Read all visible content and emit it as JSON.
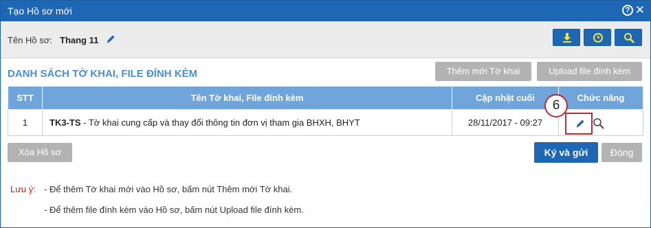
{
  "dialog": {
    "title": "Tạo Hồ sơ mới",
    "help_icon": "question-circle-icon",
    "close_icon": "close-icon"
  },
  "profile": {
    "label": "Tên Hồ sơ:",
    "name": "Thang 11",
    "edit_icon": "pencil-icon"
  },
  "toolbar": {
    "download_icon": "download-icon",
    "history_icon": "clock-icon",
    "search_icon": "search-icon",
    "accent": "#1d67b5"
  },
  "section": {
    "title": "DANH SÁCH TỜ KHAI, FILE ĐÍNH KÈM",
    "add_form_label": "Thêm mới Tờ khai",
    "upload_label": "Upload file đính kèm"
  },
  "table": {
    "headers": {
      "stt": "STT",
      "name": "Tên Tờ khai, File đính kèm",
      "updated": "Cập nhật cuối",
      "actions": "Chức năng"
    },
    "rows": [
      {
        "stt": "1",
        "code": "TK3-TS",
        "description": " - Tờ khai cung cấp và thay đổi thông tin đơn vị tham gia BHXH, BHYT",
        "updated": "28/11/2017 - 09:27",
        "actions": [
          "pencil-icon",
          "search-icon"
        ]
      }
    ]
  },
  "callout": {
    "step": "6",
    "color": "#c1272d"
  },
  "footer": {
    "delete_label": "Xóa Hồ sơ",
    "sign_send_label": "Ký và gửi",
    "close_label": "Đóng"
  },
  "notes": {
    "label": "Lưu ý:",
    "lines": [
      "- Để thêm Tờ khai mới vào Hồ sơ, bấm nút Thêm mới Tờ khai.",
      "- Để thêm file đính kèm vào Hồ sơ, bấm nút Upload file đính kèm."
    ]
  }
}
